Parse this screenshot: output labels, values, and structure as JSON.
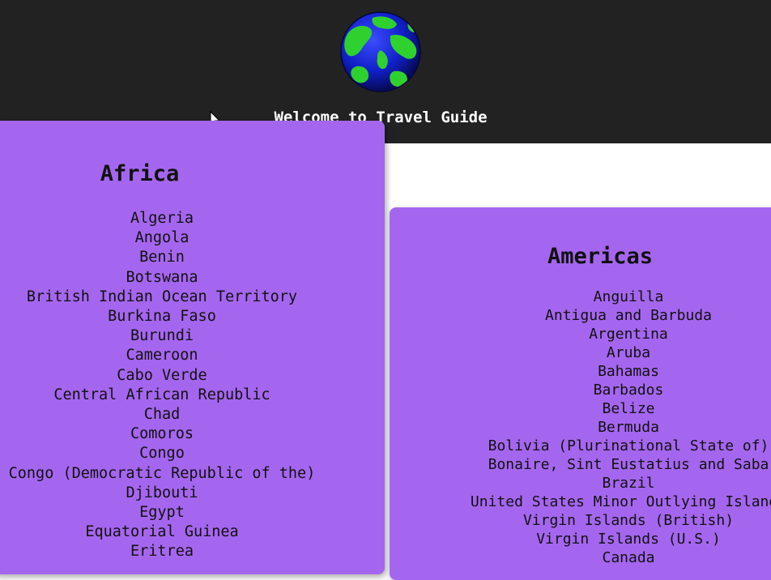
{
  "header": {
    "logo_icon": "globe-icon",
    "welcome": "Welcome to Travel Guide"
  },
  "regions": {
    "africa": {
      "title": "Africa",
      "countries": [
        "Algeria",
        "Angola",
        "Benin",
        "Botswana",
        "British Indian Ocean Territory",
        "Burkina Faso",
        "Burundi",
        "Cameroon",
        "Cabo Verde",
        "Central African Republic",
        "Chad",
        "Comoros",
        "Congo",
        "Congo (Democratic Republic of the)",
        "Djibouti",
        "Egypt",
        "Equatorial Guinea",
        "Eritrea"
      ]
    },
    "americas": {
      "title": "Americas",
      "countries": [
        "Anguilla",
        "Antigua and Barbuda",
        "Argentina",
        "Aruba",
        "Bahamas",
        "Barbados",
        "Belize",
        "Bermuda",
        "Bolivia (Plurinational State of)",
        "Bonaire, Sint Eustatius and Saba",
        "Brazil",
        "United States Minor Outlying Islands",
        "Virgin Islands (British)",
        "Virgin Islands (U.S.)",
        "Canada"
      ]
    }
  },
  "colors": {
    "header_bg": "#222222",
    "card_bg": "#a566ef"
  }
}
